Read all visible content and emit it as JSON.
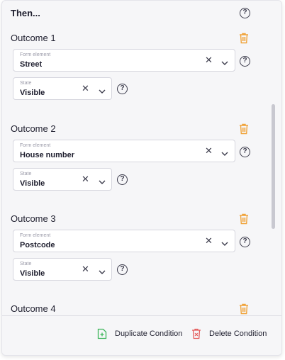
{
  "header": {
    "title": "Then..."
  },
  "outcomes": [
    {
      "title": "Outcome 1",
      "form_element": {
        "label": "Form element",
        "value": "Street"
      },
      "state": {
        "label": "State",
        "value": "Visible"
      }
    },
    {
      "title": "Outcome 2",
      "form_element": {
        "label": "Form element",
        "value": "House number"
      },
      "state": {
        "label": "State",
        "value": "Visible"
      }
    },
    {
      "title": "Outcome 3",
      "form_element": {
        "label": "Form element",
        "value": "Postcode"
      },
      "state": {
        "label": "State",
        "value": "Visible"
      }
    },
    {
      "title": "Outcome 4"
    }
  ],
  "glyphs": {
    "help": "?",
    "clear": "✕"
  },
  "footer": {
    "duplicate_label": "Duplicate Condition",
    "delete_label": "Delete Condition"
  },
  "colors": {
    "trash_orange": "#f0a33a",
    "duplicate_green": "#3cb55a",
    "delete_red": "#e45a5a"
  }
}
